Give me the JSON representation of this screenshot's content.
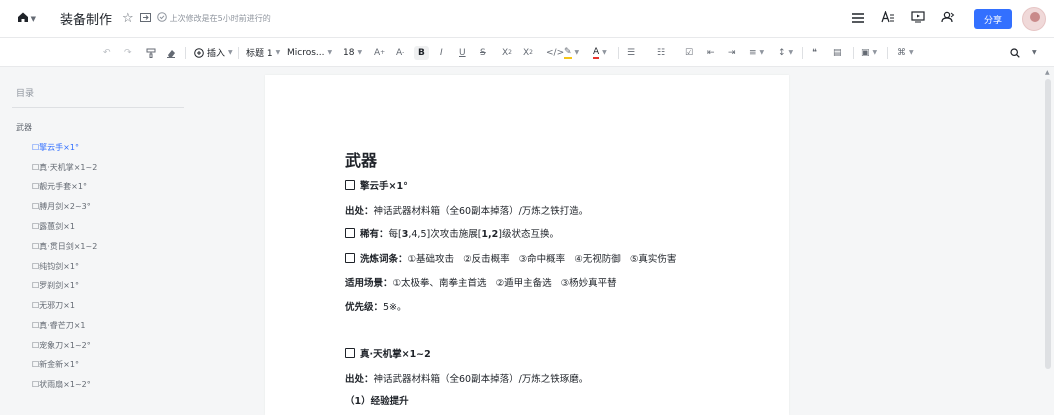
{
  "topbar": {
    "title": "装备制作",
    "saved_text": "上次修改是在5小时前进行的",
    "share_label": "分享"
  },
  "toolbar": {
    "insert_label": "插入",
    "heading_label": "标题 1",
    "font_label": "Micros...",
    "size_label": "18"
  },
  "sidebar": {
    "heading": "目录",
    "items": [
      {
        "label": "武器",
        "level": 1
      },
      {
        "label": "☐擎云手×1°",
        "level": 2,
        "active": true
      },
      {
        "label": "☐真·天机掌×1~2",
        "level": 2
      },
      {
        "label": "☐靓元手套×1°",
        "level": 2
      },
      {
        "label": "☐膊月剑×2~3°",
        "level": 2
      },
      {
        "label": "☐露蕙剑×1",
        "level": 2
      },
      {
        "label": "☐真·贯日剑×1~2",
        "level": 2
      },
      {
        "label": "☐纯钧剑×1°",
        "level": 2
      },
      {
        "label": "☐罗刹剑×1°",
        "level": 2
      },
      {
        "label": "☐无邪刀×1",
        "level": 2
      },
      {
        "label": "☐真·睿芒刀×1",
        "level": 2
      },
      {
        "label": "☐宠象刀×1~2°",
        "level": 2
      },
      {
        "label": "☐新金新×1°",
        "level": 2
      },
      {
        "label": "☐状雨扇×1~2°",
        "level": 2
      }
    ]
  },
  "document": {
    "heading": "武器",
    "item1_title": "擎云手×1°",
    "item1_source_label": "出处：",
    "item1_source": "神话武器材料箱（全60副本掉落）/万炼之铁打造。",
    "rare_label": "稀有：",
    "rare_pre": "每[",
    "rare_b1": "3",
    "rare_mid": ",4,5]次攻击施展[",
    "rare_b2": "1,2",
    "rare_post": "]级状态互换。",
    "affix_label": "洗炼词条：",
    "affix_text": "①基础攻击   ②反击概率   ③命中概率   ④无视防御   ⑤真实伤害",
    "scene_label": "适用场景：",
    "scene_text": "①太极拳、南拳主首选   ②遁甲主备选   ③杨妙真平替",
    "priority_label": "优先级：",
    "priority_text": "5※。",
    "item2_title": "真·天机掌×1~2",
    "item2_source_label": "出处：",
    "item2_source": "神话武器材料箱（全60副本掉落）/万炼之铁琢磨。",
    "item2_next": "（1）经验提升"
  },
  "icons": {
    "home": "home-icon",
    "star": "star-icon",
    "folder": "folder-icon",
    "check": "saved-check-icon"
  },
  "colors": {
    "accent": "#3370ff",
    "highlight": "#f5c518",
    "font_color": "#e8342d"
  }
}
